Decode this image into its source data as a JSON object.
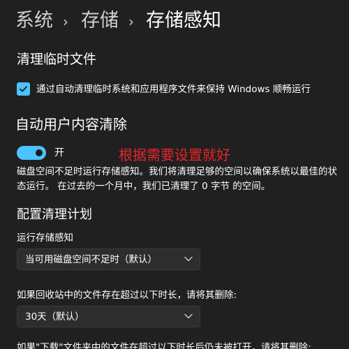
{
  "breadcrumb": {
    "items": [
      "系统",
      "存储",
      "存储感知"
    ],
    "separator": "›"
  },
  "temp_files": {
    "title": "清理临时文件",
    "checkbox_label": "通过自动清理临时系统和应用程序文件来保持 Windows 顺畅运行",
    "checked": true
  },
  "auto_cleanup": {
    "title": "自动用户内容清除",
    "toggle_state": "开",
    "toggle_on": true,
    "annotation": "根据需要设置就好",
    "description": "磁盘空间不足时运行存储感知。我们将清理足够的空间以确保系统以最佳的状态运行。 在过去的一个月中，我们已清理了 0 字节 的空间。"
  },
  "schedule": {
    "title": "配置清理计划",
    "run_label": "运行存储感知",
    "run_value": "当可用磁盘空间不足时（默认）",
    "recycle_label": "如果回收站中的文件存在超过以下时长，请将其删除:",
    "recycle_value": "30天（默认）",
    "next_partial": "如果\"下载\"文件夹中的文件在超过以下时长后仍未被打开，请将其删除:"
  },
  "colors": {
    "background": "#202020",
    "accent": "#4cc2ff",
    "annotation": "#e8242a"
  },
  "icons": {
    "checkbox": "checkmark-icon",
    "dropdown": "chevron-down-icon"
  }
}
